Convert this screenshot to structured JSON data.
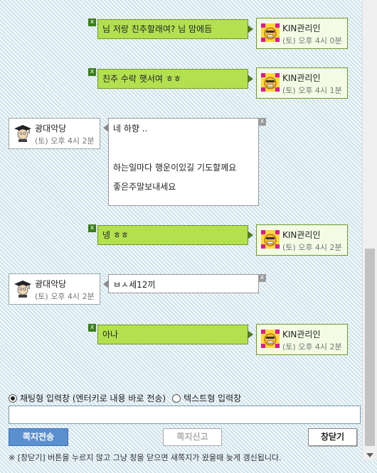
{
  "messages": [
    {
      "type": "sent",
      "text": "님 저랑 친추할래여? 님 맘에듬",
      "sender": "KIN관리인",
      "time": "(토) 오후 4시 0분"
    },
    {
      "type": "sent",
      "text": "친추 수락 햇서여 ㅎㅎ",
      "sender": "KIN관리인",
      "time": "(토) 오후 4시 1분"
    },
    {
      "type": "received",
      "sender": "광대악당",
      "time": "(토) 오후 4시 2분",
      "lines": [
        "네 하향 ..",
        "하는일마다 행운이있길 기도할께요",
        "좋은주말보내세요"
      ]
    },
    {
      "type": "sent",
      "text": "넹 ㅎㅎ",
      "sender": "KIN관리인",
      "time": "(토) 오후 4시 2분"
    },
    {
      "type": "received",
      "sender": "광대악당",
      "time": "(토) 오후 4시 2분",
      "lines": [
        "ㅂㅅ세12끼"
      ]
    },
    {
      "type": "sent",
      "text": "아나",
      "sender": "KIN관리인",
      "time": "(토) 오후 4시 2분"
    }
  ],
  "input_mode": {
    "chat_label": "채팅형 입력창 (엔터키로 내용 바로 전송)",
    "text_label": "텍스트형 입력창",
    "selected": "chat"
  },
  "chat_input": {
    "value": ""
  },
  "buttons": {
    "send": "쪽지전송",
    "report": "쪽지신고",
    "close": "창닫기"
  },
  "notice": "※ [창닫기] 버튼을 누르지 않고 그냥 창을 닫으면 새쪽지가 왔을때 늦게 갱신됩니다.",
  "icons": {
    "close_box": "x",
    "admin_avatar": "face-icon",
    "user_avatar": "graduate-icon"
  },
  "colors": {
    "sent_bubble": "#b2e04f",
    "send_button": "#5a8fd0"
  }
}
